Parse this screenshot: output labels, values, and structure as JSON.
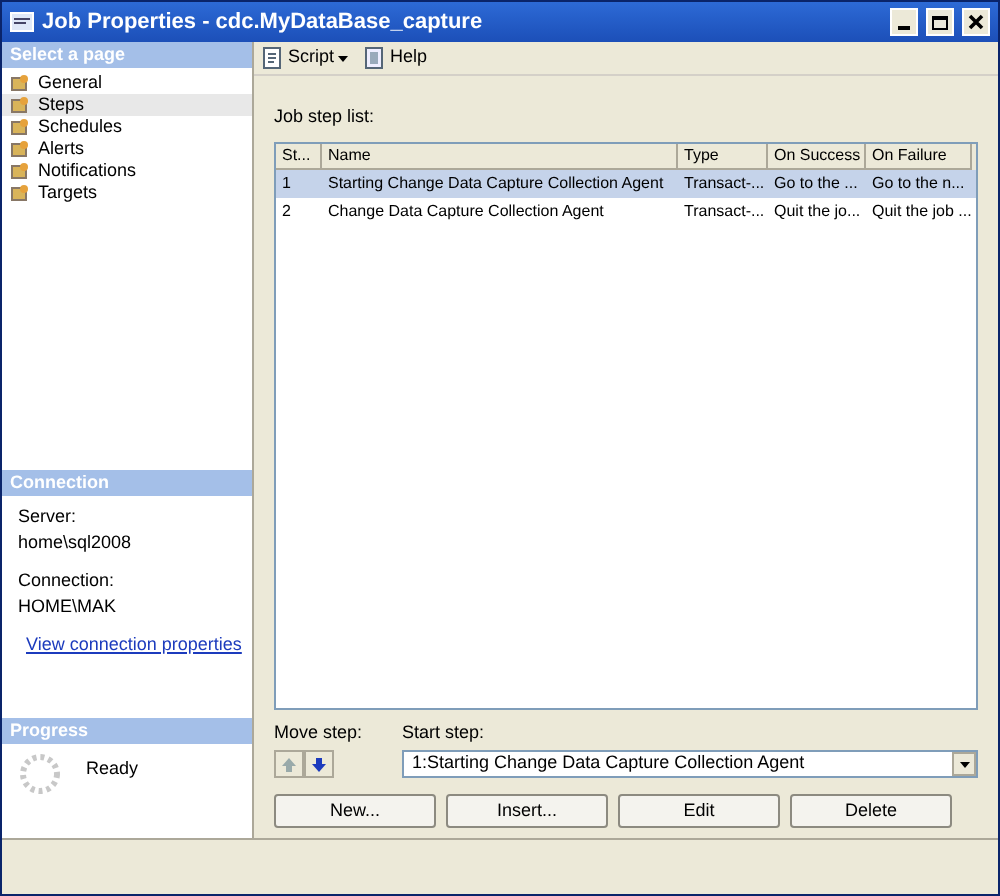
{
  "window": {
    "title": "Job Properties - cdc.MyDataBase_capture"
  },
  "sidebar": {
    "header": "Select a page",
    "items": [
      {
        "label": "General",
        "selected": false
      },
      {
        "label": "Steps",
        "selected": true
      },
      {
        "label": "Schedules",
        "selected": false
      },
      {
        "label": "Alerts",
        "selected": false
      },
      {
        "label": "Notifications",
        "selected": false
      },
      {
        "label": "Targets",
        "selected": false
      }
    ]
  },
  "connection": {
    "header": "Connection",
    "server_label": "Server:",
    "server": "home\\sql2008",
    "connection_label": "Connection:",
    "connection": "HOME\\MAK",
    "link": "View connection properties"
  },
  "progress": {
    "header": "Progress",
    "status": "Ready"
  },
  "toolbar": {
    "script": "Script",
    "help": "Help"
  },
  "job_step_list": {
    "label": "Job step list:",
    "columns": [
      "St...",
      "Name",
      "Type",
      "On Success",
      "On Failure"
    ],
    "rows": [
      {
        "cells": [
          "1",
          "Starting Change Data Capture Collection Agent",
          "Transact-...",
          "Go to the ...",
          "Go to the n..."
        ],
        "selected": true
      },
      {
        "cells": [
          "2",
          "Change Data Capture Collection Agent",
          "Transact-...",
          "Quit the jo...",
          "Quit the job ..."
        ],
        "selected": false
      }
    ]
  },
  "move_step": {
    "label": "Move step:"
  },
  "start_step": {
    "label": "Start step:",
    "value": "1:Starting Change Data Capture Collection Agent"
  },
  "buttons": [
    "New...",
    "Insert...",
    "Edit",
    "Delete"
  ]
}
